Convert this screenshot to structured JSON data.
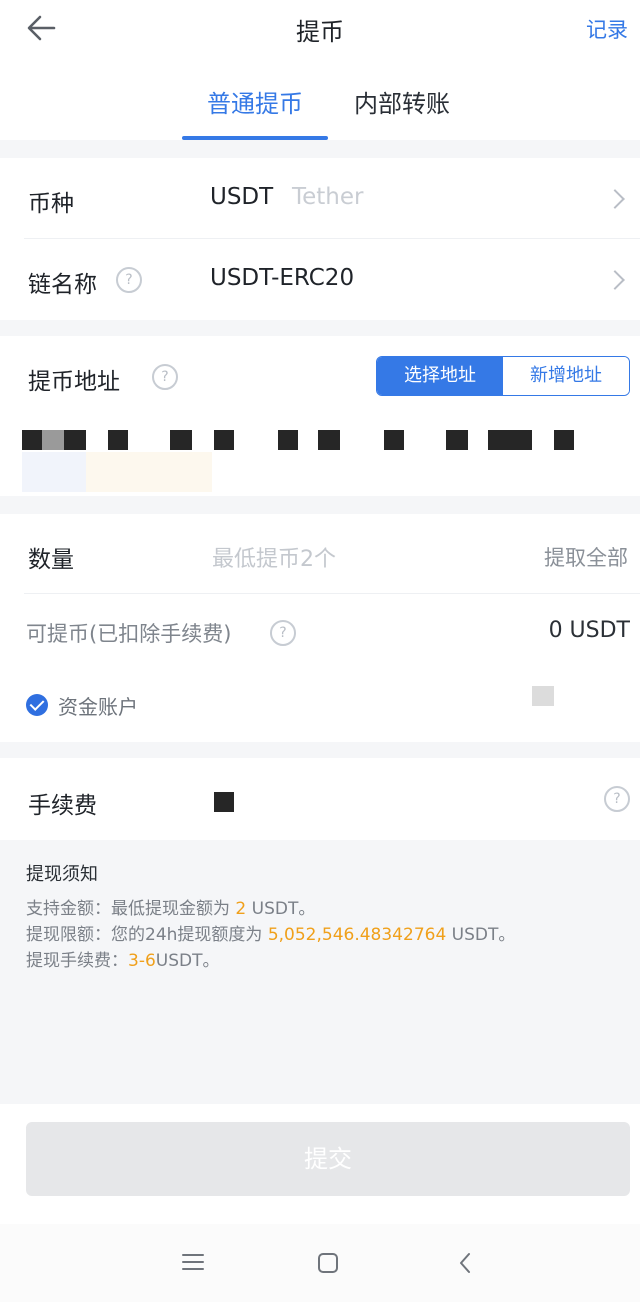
{
  "header": {
    "title": "提币",
    "records_label": "记录"
  },
  "tabs": [
    {
      "label": "普通提币",
      "active": true
    },
    {
      "label": "内部转账",
      "active": false
    }
  ],
  "currency": {
    "label": "币种",
    "value": "USDT",
    "sub": "Tether"
  },
  "chain": {
    "label": "链名称",
    "value": "USDT-ERC20"
  },
  "address": {
    "label": "提币地址",
    "select_label": "选择地址",
    "add_label": "新增地址"
  },
  "amount": {
    "label": "数量",
    "placeholder": "最低提币2个",
    "withdraw_all": "提取全部"
  },
  "available": {
    "label": "可提币(已扣除手续费)",
    "value": "0 USDT"
  },
  "fund_account": {
    "label": "资金账户",
    "checked": true
  },
  "fee": {
    "label": "手续费"
  },
  "notice": {
    "title": "提现须知",
    "line1_prefix": "支持金额：最低提现金额为 ",
    "line1_value": "2",
    "line1_suffix": " USDT。",
    "line2_prefix": "提现限额：您的24h提现额度为 ",
    "line2_value": "5,052,546.48342764",
    "line2_suffix": " USDT。",
    "line3_prefix": "提现手续费：",
    "line3_value": "3-6",
    "line3_suffix": "USDT。"
  },
  "submit_label": "提交",
  "colors": {
    "accent": "#3579e6",
    "highlight": "#f0a01b",
    "disabled_button": "#e6e7e9"
  },
  "icons": [
    "back-arrow-icon",
    "chevron-right-icon",
    "question-icon",
    "check-circle-icon",
    "menu-icon",
    "home-square-icon",
    "back-triangle-icon"
  ]
}
